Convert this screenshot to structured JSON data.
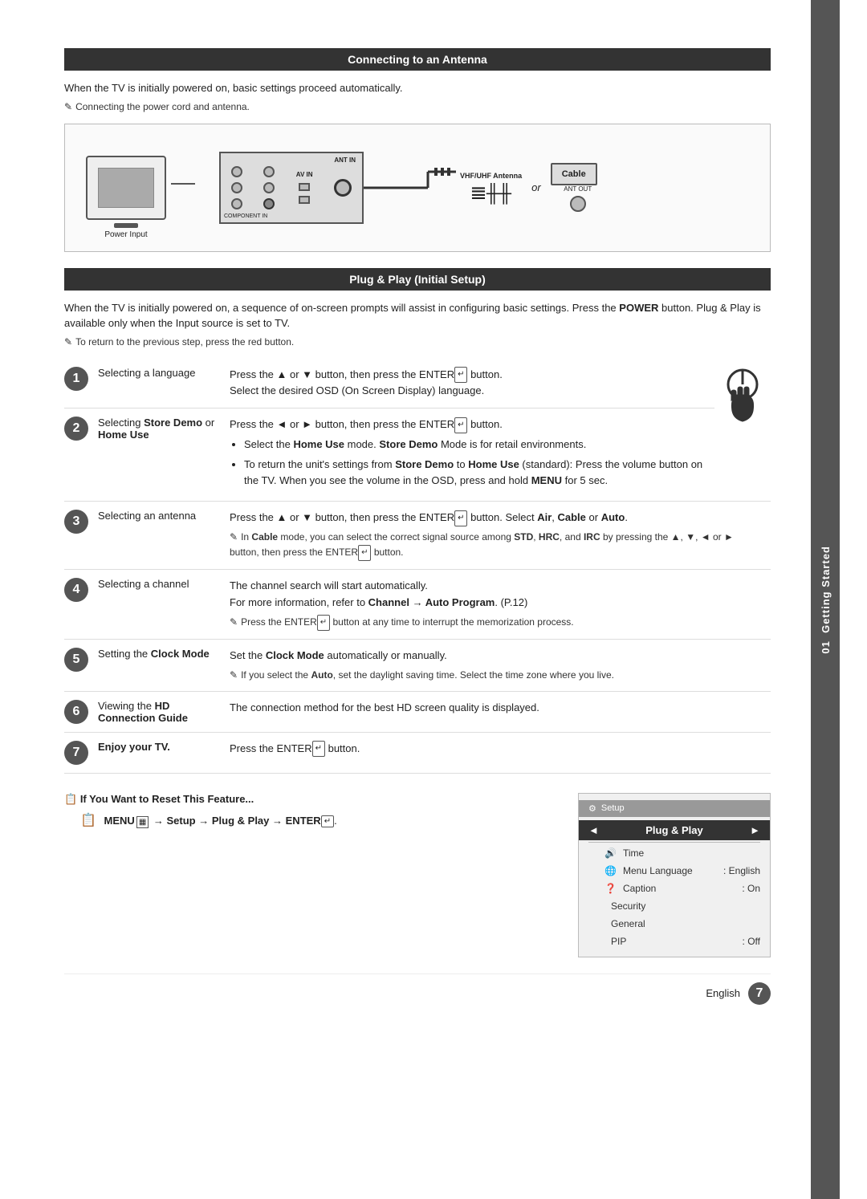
{
  "sidebar": {
    "label": "Getting Started",
    "tab_number": "01"
  },
  "antenna_section": {
    "header": "Connecting to an Antenna",
    "intro": "When the TV is initially powered on, basic settings proceed automatically.",
    "note": "Connecting the power cord and antenna.",
    "labels": {
      "power_input": "Power Input",
      "ant_in": "ANT IN",
      "component_in": "COMPONENT IN",
      "av_in": "AV IN",
      "vhf_uhf": "VHF/UHF Antenna",
      "or": "or",
      "cable": "Cable",
      "ant_out": "ANT OUT"
    }
  },
  "plug_play_section": {
    "header": "Plug & Play (Initial Setup)",
    "intro": "When the TV is initially powered on, a sequence of on-screen prompts will assist in configuring basic settings. Press the",
    "intro2": "button. Plug & Play is available only when the Input source is set to TV.",
    "power_bold": "POWER",
    "note": "To return to the previous step, press the red button.",
    "steps": [
      {
        "num": "1",
        "label": "Selecting a language",
        "desc": "Press the ▲ or ▼ button, then press the ENTER button.",
        "desc2": "Select the desired OSD (On Screen Display) language.",
        "note": null,
        "has_power": true
      },
      {
        "num": "2",
        "label": "Selecting Store Demo or Home Use",
        "label_bold": "Store Demo",
        "label_bold2": "Home Use",
        "desc": "Press the ◄ or ► button, then press the ENTER button.",
        "bullets": [
          "Select the Home Use mode. Store Demo Mode is for retail environments.",
          "To return the unit's settings from Store Demo to Home Use (standard): Press the volume button on the TV. When you see the volume in the OSD, press and hold MENU for 5 sec."
        ],
        "has_power": false
      },
      {
        "num": "3",
        "label": "Selecting an antenna",
        "desc": "Press the ▲ or ▼ button, then press the ENTER button. Select Air, Cable or Auto.",
        "note": "In Cable mode, you can select the correct signal source among STD, HRC, and IRC by pressing the ▲, ▼, ◄ or ► button, then press the ENTER button.",
        "has_power": false
      },
      {
        "num": "4",
        "label": "Selecting a channel",
        "desc": "The channel search will start automatically.",
        "desc2": "For more information, refer to Channel → Auto Program. (P.12)",
        "note": "Press the ENTER button at any time to interrupt the memorization process.",
        "has_power": false
      },
      {
        "num": "5",
        "label": "Setting the Clock Mode",
        "label_bold": "Clock",
        "label_bold2": "Mode",
        "desc": "Set the Clock Mode automatically or manually.",
        "note": "If you select the Auto, set the daylight saving time. Select the time zone where you live.",
        "has_power": false
      },
      {
        "num": "6",
        "label": "Viewing the HD Connection Guide",
        "label_bold": "HD",
        "label_bold2": "Connection Guide",
        "desc": "The connection method for the best HD screen quality is displayed.",
        "has_power": false
      },
      {
        "num": "7",
        "label": "Enjoy your TV.",
        "desc": "Press the ENTER button.",
        "has_power": false
      }
    ]
  },
  "reset_section": {
    "title": "If You Want to Reset This Feature...",
    "instruction": "MENU  → Setup → Plug & Play → ENTER .",
    "menu_screenshot": {
      "header_icon": "⚙",
      "header_text": "Setup",
      "selected_item": "Plug & Play",
      "items": [
        {
          "icon": "🔊",
          "label": "Time",
          "value": ""
        },
        {
          "icon": "🌐",
          "label": "Menu Language",
          "value": ": English"
        },
        {
          "icon": "❓",
          "label": "Caption",
          "value": ": On"
        },
        {
          "icon": "",
          "label": "Security",
          "value": ""
        },
        {
          "icon": "",
          "label": "General",
          "value": ""
        },
        {
          "icon": "",
          "label": "PIP",
          "value": ": Off"
        }
      ]
    }
  },
  "footer": {
    "language": "English",
    "page_number": "7"
  }
}
